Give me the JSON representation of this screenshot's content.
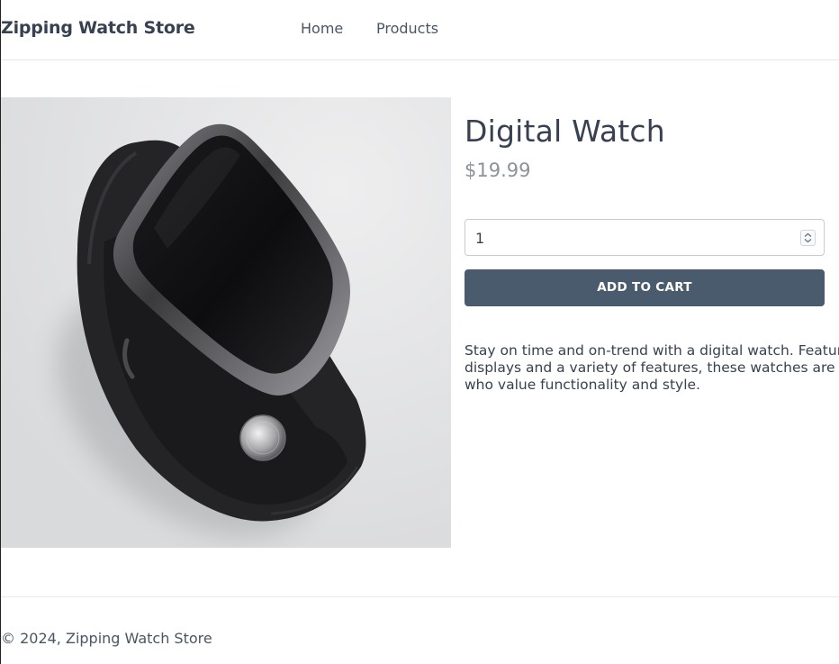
{
  "header": {
    "brand": "Zipping Watch Store",
    "nav": [
      {
        "label": "Home"
      },
      {
        "label": "Products"
      }
    ]
  },
  "product": {
    "image_icon": "watch-image",
    "title": "Digital Watch",
    "price": "$19.99",
    "quantity": {
      "value": "1",
      "spinner_icon": "spinner-arrows-icon"
    },
    "add_to_cart_label": "ADD TO CART",
    "description_lines": [
      "Stay on time and on-trend with a digital watch. Featuring c",
      "displays and a variety of features, these watches are perfe",
      "who value functionality and style."
    ]
  },
  "footer": {
    "copyright": "© 2024, Zipping Watch Store"
  },
  "colors": {
    "button_bg": "#4b5b6e",
    "text": "#374151",
    "price": "#8d9299",
    "divider": "#e5e7eb"
  }
}
